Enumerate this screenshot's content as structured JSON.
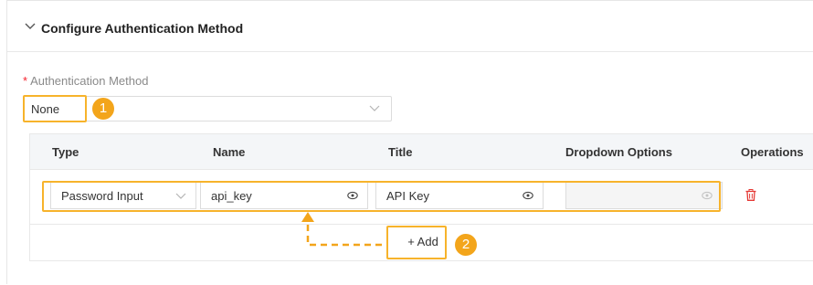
{
  "section": {
    "title": "Configure Authentication Method"
  },
  "auth_method": {
    "label": "Authentication Method",
    "required_mark": "*",
    "value": "None"
  },
  "table": {
    "columns": [
      "Type",
      "Name",
      "Title",
      "Dropdown Options",
      "Operations"
    ],
    "rows": [
      {
        "type": "Password Input",
        "name": "api_key",
        "title": "API Key",
        "dropdown_options": ""
      }
    ]
  },
  "add_button": {
    "label": "+ Add"
  },
  "badges": [
    "1",
    "2"
  ],
  "colors": {
    "highlight": "#f7b32b",
    "badge": "#f3a51b",
    "danger": "#e53935"
  },
  "icons": [
    "chevron-down-icon",
    "eye-icon",
    "trash-icon",
    "arrow-up-icon"
  ]
}
